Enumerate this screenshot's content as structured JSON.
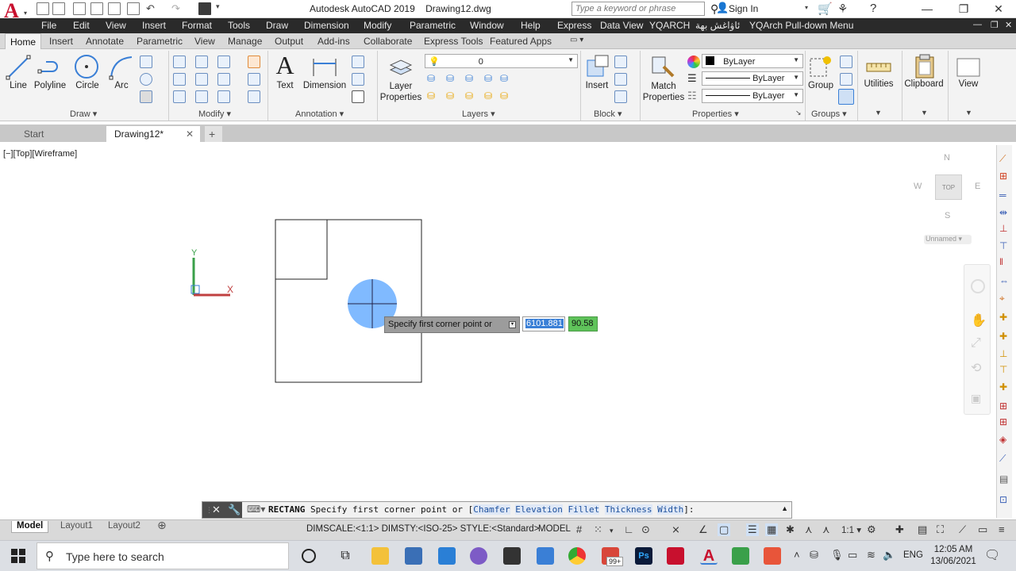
{
  "titlebar": {
    "app_name": "Autodesk AutoCAD 2019",
    "file_name": "Drawing12.dwg",
    "search_placeholder": "Type a keyword or phrase",
    "sign_in": "Sign In"
  },
  "menubar": [
    "File",
    "Edit",
    "View",
    "Insert",
    "Format",
    "Tools",
    "Draw",
    "Dimension",
    "Modify",
    "Parametric",
    "Window",
    "Help",
    "Express",
    "Data View",
    "YQARCH",
    "ئاۋاغش بهة",
    "YQArch Pull-down Menu"
  ],
  "ribbon_tabs": [
    "Home",
    "Insert",
    "Annotate",
    "Parametric",
    "View",
    "Manage",
    "Output",
    "Add-ins",
    "Collaborate",
    "Express Tools",
    "Featured Apps"
  ],
  "ribbon": {
    "draw": {
      "title": "Draw",
      "tools": [
        "Line",
        "Polyline",
        "Circle",
        "Arc"
      ]
    },
    "modify": {
      "title": "Modify"
    },
    "annotation": {
      "title": "Annotation",
      "tools": [
        "Text",
        "Dimension"
      ]
    },
    "layers": {
      "title": "Layers",
      "layer_properties": "Layer Properties",
      "current_layer": "0"
    },
    "block": {
      "title": "Block",
      "insert": "Insert"
    },
    "properties": {
      "title": "Properties",
      "match": "Match Properties",
      "color": "ByLayer",
      "linetype": "ByLayer",
      "lineweight": "ByLayer"
    },
    "groups": {
      "title": "Groups",
      "group": "Group"
    },
    "utilities": "Utilities",
    "clipboard": "Clipboard",
    "view": "View"
  },
  "doc_tabs": [
    "Start",
    "Drawing12*"
  ],
  "viewport_label": "[−][Top][Wireframe]",
  "viewcube": {
    "top": "TOP",
    "n": "N",
    "s": "S",
    "e": "E",
    "w": "W",
    "ucs_name": "Unnamed"
  },
  "ucs": {
    "x": "X",
    "y": "Y"
  },
  "dynamic_input": {
    "prompt": "Specify first corner point or",
    "x_value": "6101.881",
    "y_value": "90.58"
  },
  "command_line": {
    "command": "RECTANG",
    "text": "Specify first corner point or [",
    "options": [
      "Chamfer",
      "Elevation",
      "Fillet",
      "Thickness",
      "Width"
    ],
    "suffix": "]:"
  },
  "layout_tabs": [
    "Model",
    "Layout1",
    "Layout2"
  ],
  "statusbar": {
    "text": "DIMSCALE:<1:1> DIMSTY:<ISO-25> STYLE:<Standard>",
    "model": "MODEL",
    "scale": "1:1"
  },
  "taskbar": {
    "search_placeholder": "Type here to search",
    "language": "ENG",
    "time": "12:05 AM",
    "date": "13/06/2021",
    "badge": "99+"
  },
  "colors": {
    "accent": "#c8102e",
    "menubar": "#2a2a2a",
    "dyn_y_bg": "#5fc35a",
    "cursor_circle": "#6aaeff"
  }
}
